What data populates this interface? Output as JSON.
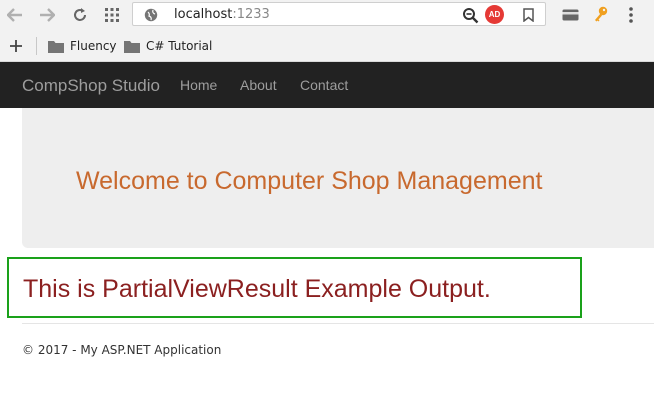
{
  "browser": {
    "url_host": "localhost",
    "url_port": ":1233",
    "adblock_badge": "AD",
    "bookmarks": [
      {
        "label": "Fluency"
      },
      {
        "label": "C# Tutorial"
      }
    ],
    "colors": {
      "chrome_bg": "#f2f2f2",
      "adblock_red": "#e53935",
      "key_orange": "#f0a020"
    }
  },
  "site": {
    "brand": "CompShop Studio",
    "nav": [
      {
        "label": "Home"
      },
      {
        "label": "About"
      },
      {
        "label": "Contact"
      }
    ],
    "jumbotron_title": "Welcome to Computer Shop Management",
    "partial_output": "This is PartialViewResult Example Output.",
    "footer": "© 2017 - My ASP.NET Application",
    "colors": {
      "navbar_bg": "#222222",
      "jumbotron_bg": "#eeeeee",
      "jumbotron_text": "#c8692e",
      "partial_text": "#8b2020",
      "highlight_border": "#1aa11a"
    }
  }
}
